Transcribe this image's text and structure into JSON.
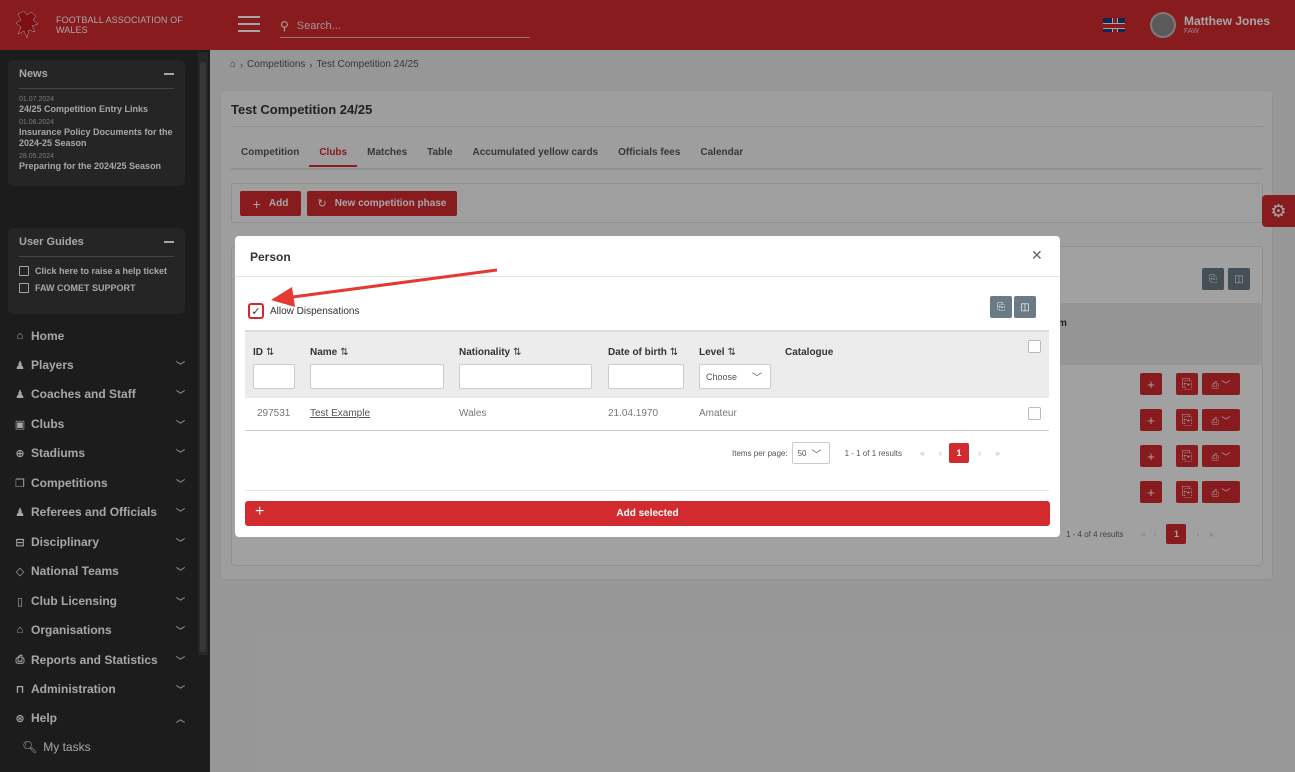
{
  "brand": {
    "name": "FOOTBALL ASSOCIATION OF WALES",
    "color": "#d12a2f"
  },
  "search": {
    "placeholder": "Search..."
  },
  "user": {
    "name": "Matthew Jones",
    "org": "FAW"
  },
  "sidebar": {
    "news": {
      "title": "News",
      "items": [
        {
          "date": "01.07.2024",
          "title": "24/25 Competition Entry Links"
        },
        {
          "date": "01.06.2024",
          "title": "Insurance Policy Documents for the 2024-25 Season"
        },
        {
          "date": "28.05.2024",
          "title": "Preparing for the 2024/25 Season"
        }
      ]
    },
    "guides": {
      "title": "User Guides",
      "items": [
        {
          "label": "Click here to raise a help ticket"
        },
        {
          "label": "FAW COMET SUPPORT"
        }
      ]
    },
    "nav": [
      {
        "label": "Home",
        "icon": "home-icon"
      },
      {
        "label": "Players",
        "icon": "players-icon"
      },
      {
        "label": "Coaches and Staff",
        "icon": "staff-icon"
      },
      {
        "label": "Clubs",
        "icon": "clubs-icon"
      },
      {
        "label": "Stadiums",
        "icon": "globe-icon"
      },
      {
        "label": "Competitions",
        "icon": "competitions-icon"
      },
      {
        "label": "Referees and Officials",
        "icon": "referees-icon"
      },
      {
        "label": "Disciplinary",
        "icon": "disciplinary-icon"
      },
      {
        "label": "National Teams",
        "icon": "tag-icon"
      },
      {
        "label": "Club Licensing",
        "icon": "bookmark-icon"
      },
      {
        "label": "Organisations",
        "icon": "building-icon"
      },
      {
        "label": "Reports and Statistics",
        "icon": "print-icon"
      },
      {
        "label": "Administration",
        "icon": "lock-icon"
      },
      {
        "label": "Help",
        "icon": "help-icon"
      }
    ],
    "sub": {
      "label": "My tasks"
    }
  },
  "breadcrumb": {
    "level1": "Competitions",
    "level2": "Test Competition 24/25"
  },
  "page": {
    "title": "Test Competition 24/25",
    "tabs": [
      {
        "label": "Competition"
      },
      {
        "label": "Clubs"
      },
      {
        "label": "Matches"
      },
      {
        "label": "Table"
      },
      {
        "label": "Accumulated yellow cards"
      },
      {
        "label": "Officials fees"
      },
      {
        "label": "Calendar"
      }
    ],
    "add_label": "Add",
    "phase_label": "New competition phase",
    "bg_header_partial": "m",
    "bg_results": "1 - 4 of 4 results",
    "bg_page": "1"
  },
  "modal": {
    "title": "Person",
    "allow_label": "Allow Dispensations",
    "columns": {
      "id": "ID",
      "name": "Name",
      "nationality": "Nationality",
      "dob": "Date of birth",
      "level": "Level",
      "catalogue": "Catalogue"
    },
    "level_choose": "Choose",
    "row": {
      "id": "297531",
      "name": "Test Example",
      "nationality": "Wales",
      "dob": "21.04.1970",
      "level": "Amateur"
    },
    "pagination": {
      "items_per_page_label": "Items per page:",
      "per_page": "50",
      "results": "1 - 1 of 1 results",
      "page": "1"
    },
    "add_selected": "Add selected"
  }
}
